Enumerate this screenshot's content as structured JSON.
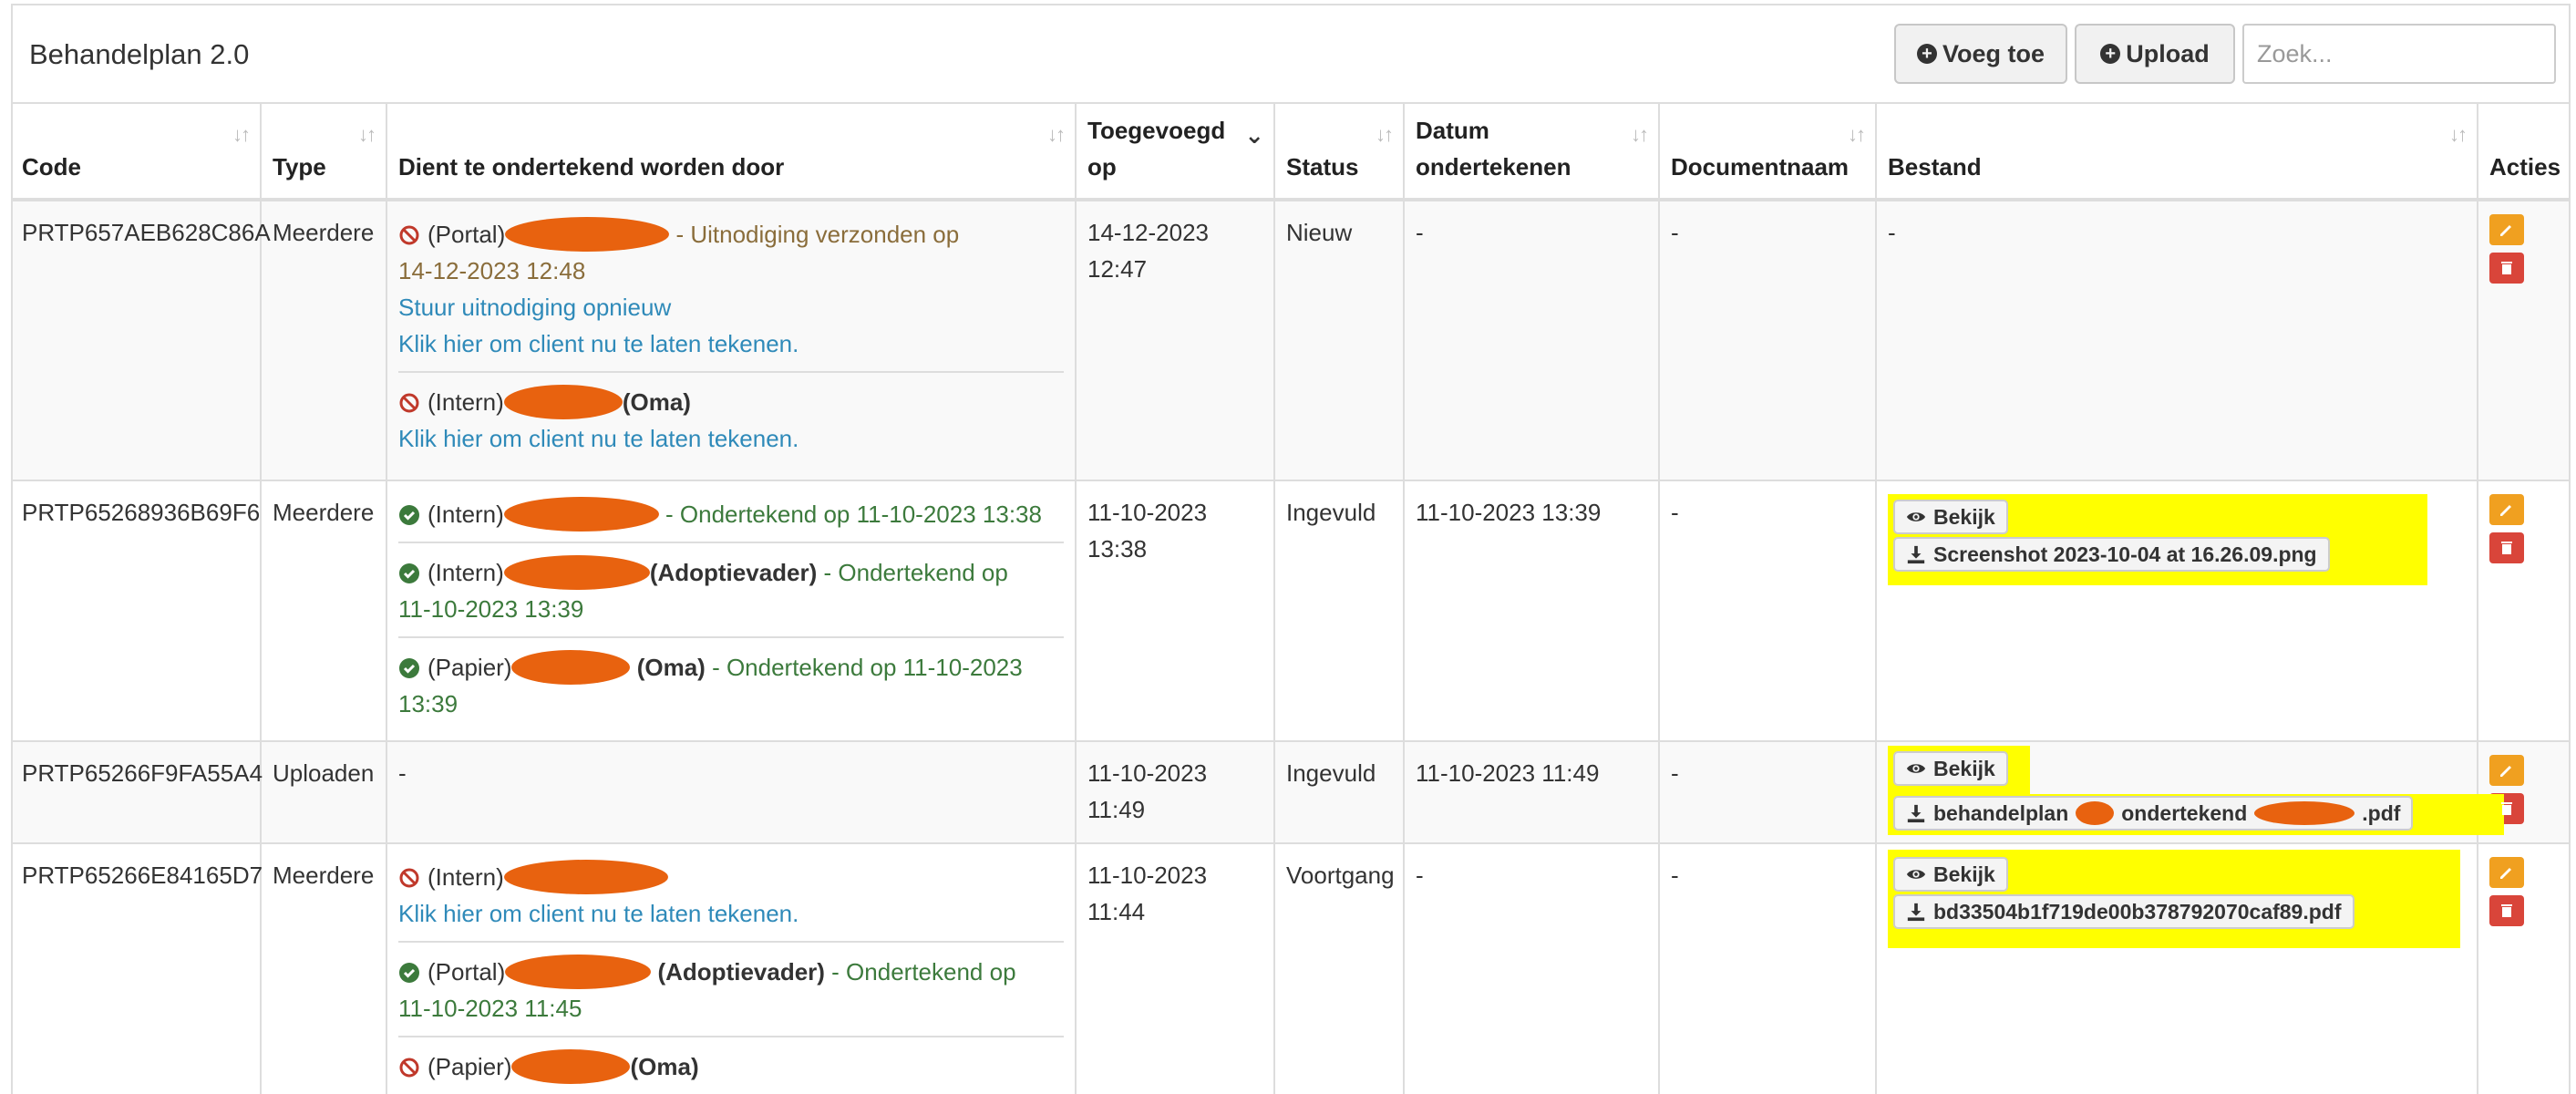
{
  "header": {
    "title": "Behandelplan 2.0",
    "add_label": "Voeg toe",
    "upload_label": "Upload",
    "search_placeholder": "Zoek..."
  },
  "columns": [
    "Code",
    "Type",
    "Dient te ondertekend worden door",
    "Toegevoegd op",
    "Status",
    "Datum ondertekenen",
    "Documentnaam",
    "Bestand",
    "Acties"
  ],
  "rows": [
    {
      "code": "PRTP657AEB628C86A",
      "type": "Meerdere",
      "signers": [
        {
          "icon": "ban",
          "line1_prefix": "(Portal)",
          "line1_suffix": " - Uitnodiging verzonden op",
          "line2": "14-12-2023 12:48",
          "status_class": "warn",
          "role": "",
          "links": [
            "Stuur uitnodiging opnieuw",
            "Klik hier om client nu te laten tekenen."
          ]
        },
        {
          "icon": "ban",
          "line1_prefix": "(Intern)",
          "role": "(Oma)",
          "links": [
            "Klik hier om client nu te laten tekenen."
          ]
        }
      ],
      "added": "14-12-2023 12:47",
      "status": "Nieuw",
      "sign_date": "-",
      "docname": "-",
      "file": "-"
    },
    {
      "code": "PRTP65268936B69F6",
      "type": "Meerdere",
      "signers": [
        {
          "icon": "check",
          "line1_prefix": "(Intern)",
          "line1_suffix": " - Ondertekend op 11-10-2023 13:38"
        },
        {
          "icon": "check",
          "line1_prefix": "(Intern)",
          "role": "(Adoptievader)",
          "line1_suffix": " - Ondertekend op",
          "line2": "11-10-2023 13:39"
        },
        {
          "icon": "check",
          "line1_prefix": "(Papier)",
          "role": "(Oma)",
          "line1_suffix": " - Ondertekend op 11-10-2023",
          "line2": "13:39"
        }
      ],
      "added": "11-10-2023 13:38",
      "status": "Ingevuld",
      "sign_date": "11-10-2023 13:39",
      "docname": "-",
      "file_view": "Bekijk",
      "file_download": "Screenshot 2023-10-04 at 16.26.09.png"
    },
    {
      "code": "PRTP65266F9FA55A4",
      "type": "Uploaden",
      "signers_text": "-",
      "added": "11-10-2023 11:49",
      "status": "Ingevuld",
      "sign_date": "11-10-2023 11:49",
      "docname": "-",
      "file_view": "Bekijk",
      "file_download_a": "behandelplan",
      "file_download_b": "ondertekend",
      "file_download_c": ".pdf"
    },
    {
      "code": "PRTP65266E84165D7",
      "type": "Meerdere",
      "signers": [
        {
          "icon": "ban",
          "line1_prefix": "(Intern)",
          "links": [
            "Klik hier om client nu te laten tekenen."
          ]
        },
        {
          "icon": "check",
          "line1_prefix": "(Portal)",
          "role": "(Adoptievader)",
          "line1_suffix": " - Ondertekend op",
          "line2": "11-10-2023 11:45"
        },
        {
          "icon": "ban",
          "line1_prefix": "(Papier)",
          "role": "(Oma)"
        }
      ],
      "added": "11-10-2023 11:44",
      "status": "Voortgang",
      "sign_date": "-",
      "docname": "-",
      "file_view": "Bekijk",
      "file_download": "bd33504b1f719de00b378792070caf89.pdf"
    }
  ],
  "colors": {
    "redaction": "#e8620f",
    "highlight": "#ffff00",
    "ok": "#3c7a3c",
    "warn": "#8a6d3b",
    "link": "#2f8ab9",
    "edit": "#f0a020",
    "delete": "#d9453a"
  },
  "icons": {
    "sort": "sort-icon",
    "sort_active": "chevron-down-icon",
    "ban": "ban-icon",
    "check": "check-circle-icon",
    "eye": "eye-icon",
    "download": "download-icon",
    "edit": "pencil-icon",
    "delete": "trash-icon"
  }
}
